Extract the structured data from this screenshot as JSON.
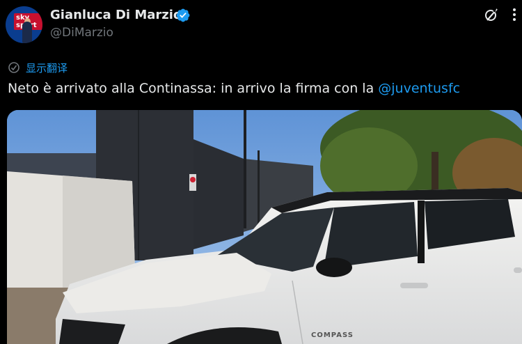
{
  "author": {
    "display_name": "Gianluca Di Marzio",
    "handle": "@DiMarzio",
    "avatar_badge": "sky sport",
    "verified": true
  },
  "icons": {
    "verified": "verified-badge-icon",
    "grok": "grok-icon",
    "more": "more-options-icon",
    "translate": "translate-icon"
  },
  "translate_label": "显示翻译",
  "tweet": {
    "text": "Neto è arrivato alla Continassa: in arrivo la firma con la ",
    "mention": "@juventusfc"
  },
  "media": {
    "car_badge": "COMPASS"
  },
  "colors": {
    "accent": "#1d9bf0",
    "text": "#e7e9ea",
    "secondary": "#71767b",
    "background": "#000000"
  }
}
